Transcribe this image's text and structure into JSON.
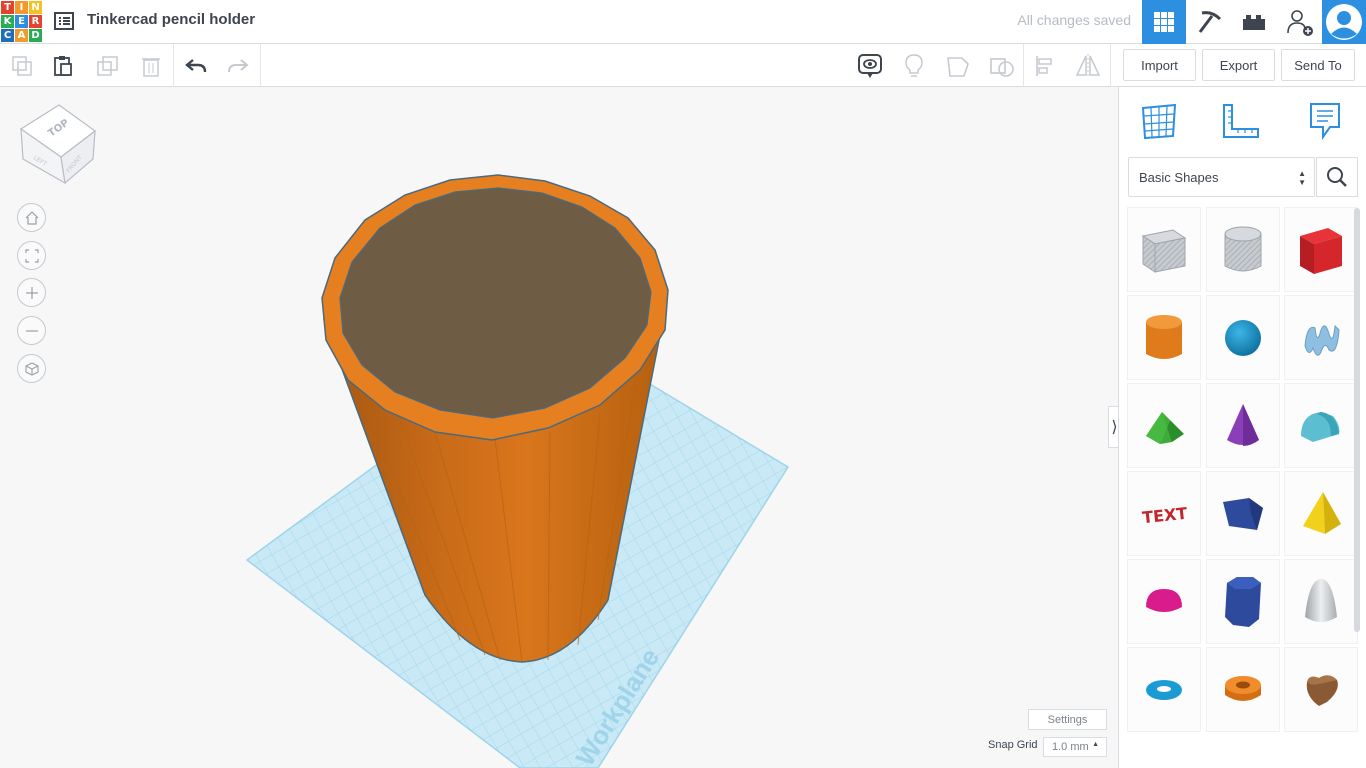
{
  "app": {
    "logo_letters": [
      "T",
      "I",
      "N",
      "K",
      "E",
      "R",
      "C",
      "A",
      "D"
    ],
    "logo_colors": [
      "#e2442f",
      "#f29a2e",
      "#f4c026",
      "#2cab55",
      "#2c8fe0",
      "#e2442f",
      "#1e6fb8",
      "#f29a2e",
      "#2cab55"
    ],
    "design_title": "Tinkercad pencil holder",
    "save_status": "All changes saved"
  },
  "header": {
    "icons": [
      "3d-design-icon",
      "codeblocks-icon",
      "bricks-icon",
      "invite-user-icon",
      "avatar-icon"
    ],
    "active_color": "#2c8fe0"
  },
  "toolbar": {
    "import_label": "Import",
    "export_label": "Export",
    "send_to_label": "Send To"
  },
  "viewport": {
    "view_cube_top": "TOP",
    "view_cube_left": "LEFT",
    "view_cube_front": "FRONT",
    "workplane_label": "Workplane",
    "settings_label": "Settings",
    "snap_grid_label": "Snap Grid",
    "snap_grid_value": "1.0 mm",
    "object_color": "#e57f1f",
    "workplane_color": "#bfe4f2"
  },
  "panel": {
    "category": "Basic Shapes",
    "shapes": [
      "box-hole",
      "cylinder-hole",
      "box",
      "cylinder",
      "sphere",
      "scribble",
      "roof",
      "cone",
      "round-roof",
      "text",
      "half-sphere-prism",
      "pyramid",
      "half-sphere",
      "polygon",
      "paraboloid",
      "torus",
      "tube",
      "heart"
    ]
  }
}
